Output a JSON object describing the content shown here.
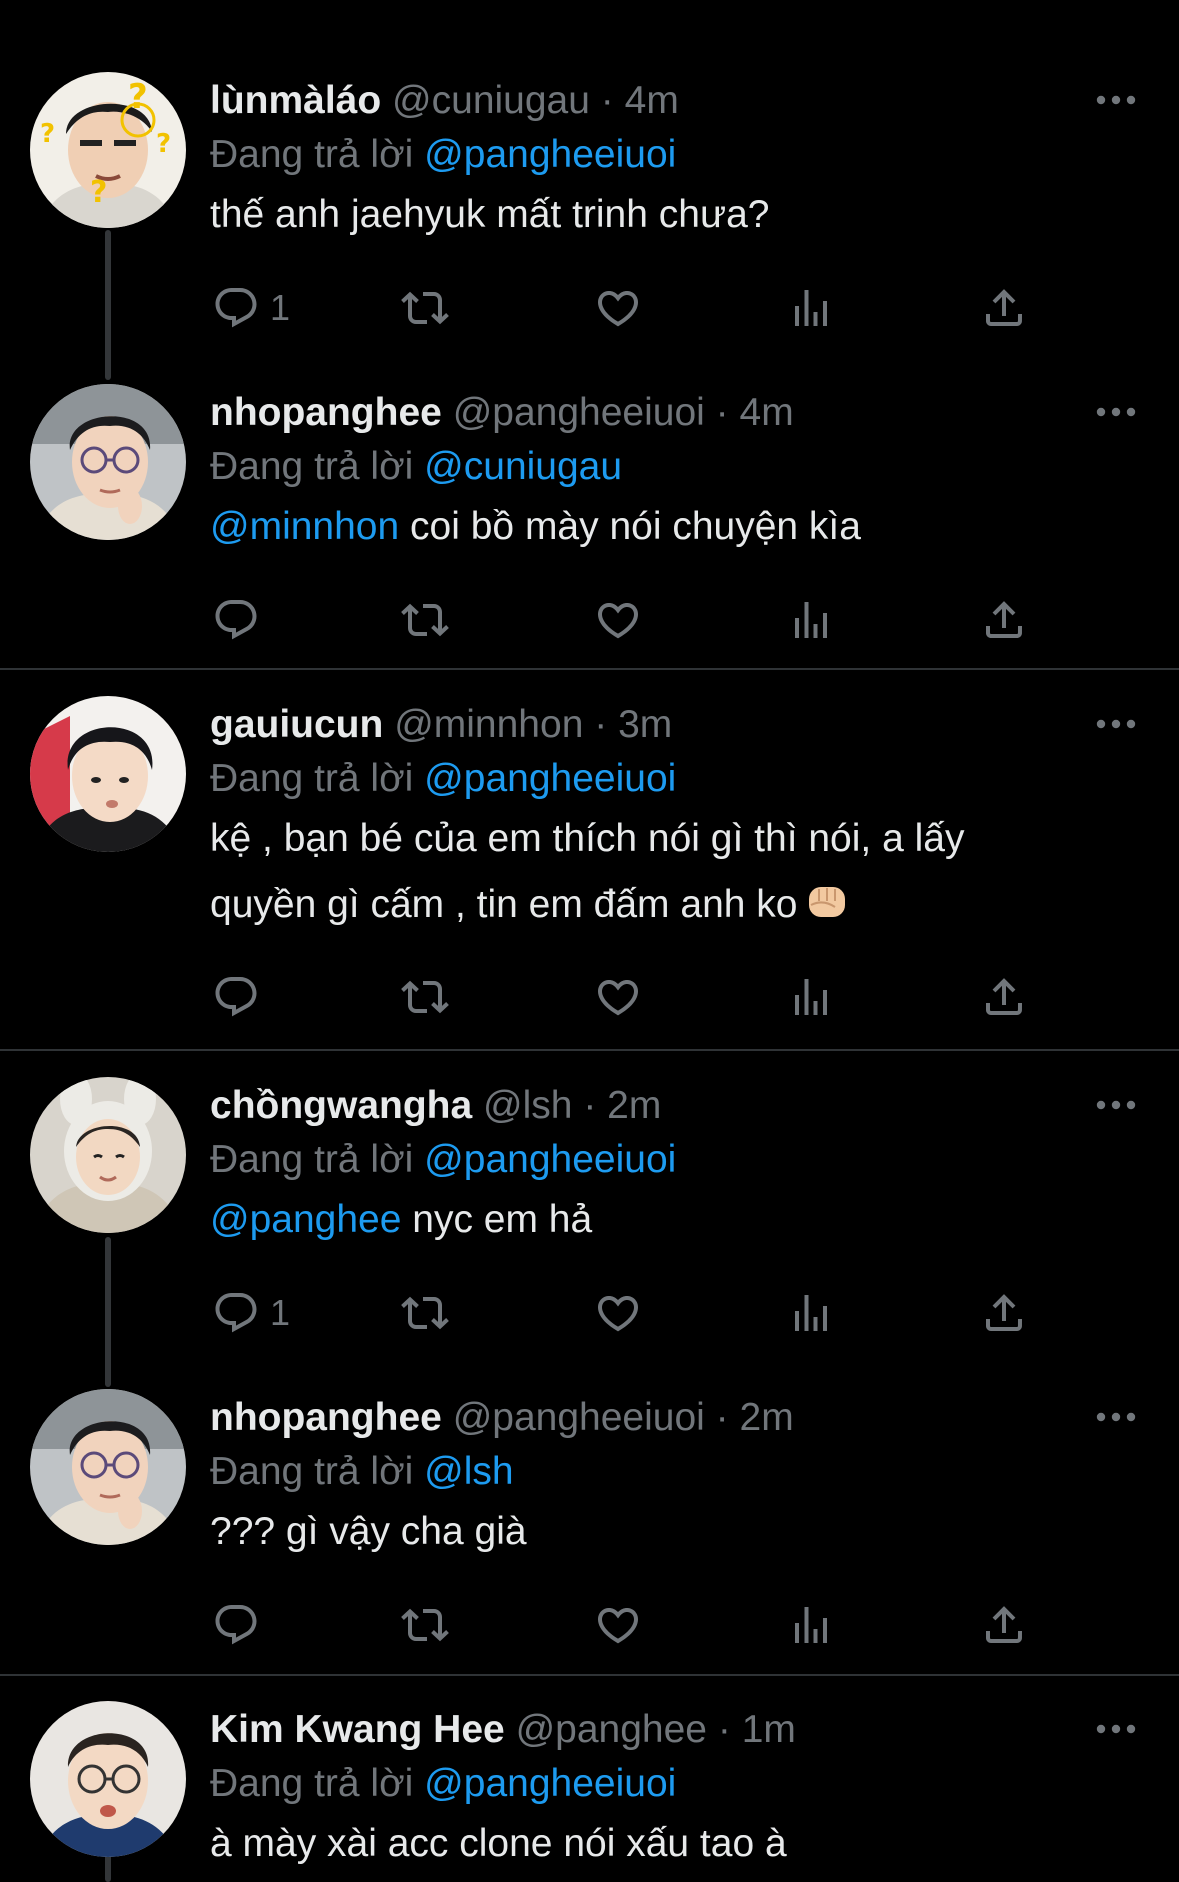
{
  "colors": {
    "background": "#000000",
    "text": "#e7e9ea",
    "muted": "#71767b",
    "mention": "#1d9bf0",
    "divider": "#2f3336"
  },
  "icons": {
    "reply": "reply-icon",
    "retweet": "retweet-icon",
    "like": "heart-icon",
    "views": "views-icon",
    "share": "share-icon",
    "more": "more-icon"
  },
  "tweets": [
    {
      "display_name": "lùnmàláo",
      "handle": "@cuniugau",
      "sep": "·",
      "time": "4m",
      "reply_prefix": "Đang trả lời",
      "reply_to": "@pangheeiuoi",
      "body": {
        "line1": "thế anh jaehyuk mất trinh chưa?"
      },
      "reply_count": "1"
    },
    {
      "display_name": "nhopanghee",
      "handle": "@pangheeiuoi",
      "sep": "·",
      "time": "4m",
      "reply_prefix": "Đang trả lời",
      "reply_to": "@cuniugau",
      "body": {
        "mention": "@minnhon",
        "text": " coi bồ mày nói chuyện kìa"
      },
      "reply_count": ""
    },
    {
      "display_name": "gauiucun",
      "handle": "@minnhon",
      "sep": "·",
      "time": "3m",
      "reply_prefix": "Đang trả lời",
      "reply_to": "@pangheeiuoi",
      "body": {
        "line1": "kệ , bạn bé của em thích nói gì thì nói, a lấy",
        "line2": "quyền gì cấm , tin em đấm anh ko"
      },
      "reply_count": ""
    },
    {
      "display_name": "chồngwangha",
      "handle": "@lsh",
      "sep": "·",
      "time": "2m",
      "reply_prefix": "Đang trả lời",
      "reply_to": "@pangheeiuoi",
      "body": {
        "mention": "@panghee",
        "text": " nyc em hả"
      },
      "reply_count": "1"
    },
    {
      "display_name": "nhopanghee",
      "handle": "@pangheeiuoi",
      "sep": "·",
      "time": "2m",
      "reply_prefix": "Đang trả lời",
      "reply_to": "@lsh",
      "body": {
        "line1": "??? gì vậy cha già"
      },
      "reply_count": ""
    },
    {
      "display_name": "Kim Kwang Hee",
      "handle": "@panghee",
      "sep": "·",
      "time": "1m",
      "reply_prefix": "Đang trả lời",
      "reply_to": "@pangheeiuoi",
      "body": {
        "line1": "à mày xài acc clone nói xấu tao à"
      },
      "reply_count": ""
    }
  ]
}
